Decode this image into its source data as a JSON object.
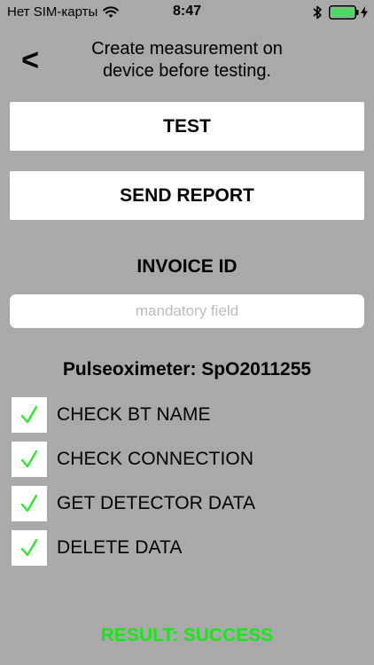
{
  "status_bar": {
    "carrier": "Нет SIM-карты",
    "time": "8:47",
    "icons": [
      "wifi-icon",
      "bluetooth-icon",
      "battery-icon",
      "charging-bolt-icon"
    ],
    "battery_color": "#4cd964"
  },
  "header": {
    "back_label": "<",
    "line1": "Create measurement on",
    "line2": "device before testing."
  },
  "buttons": {
    "test_label": "TEST",
    "send_report_label": "SEND REPORT"
  },
  "invoice": {
    "label": "INVOICE ID",
    "value": "",
    "placeholder": "mandatory field"
  },
  "device": {
    "label": "Pulseoximeter: SpO2011255"
  },
  "checklist": {
    "items": [
      {
        "label": "CHECK BT NAME",
        "checked": true
      },
      {
        "label": "CHECK CONNECTION",
        "checked": true
      },
      {
        "label": "GET DETECTOR DATA",
        "checked": true
      },
      {
        "label": "DELETE DATA",
        "checked": true
      }
    ],
    "check_color": "#2ee82e"
  },
  "result": {
    "text": "RESULT: SUCCESS",
    "color": "#17e617"
  },
  "colors": {
    "background": "#a9a9a9",
    "button_background": "#ffffff"
  }
}
